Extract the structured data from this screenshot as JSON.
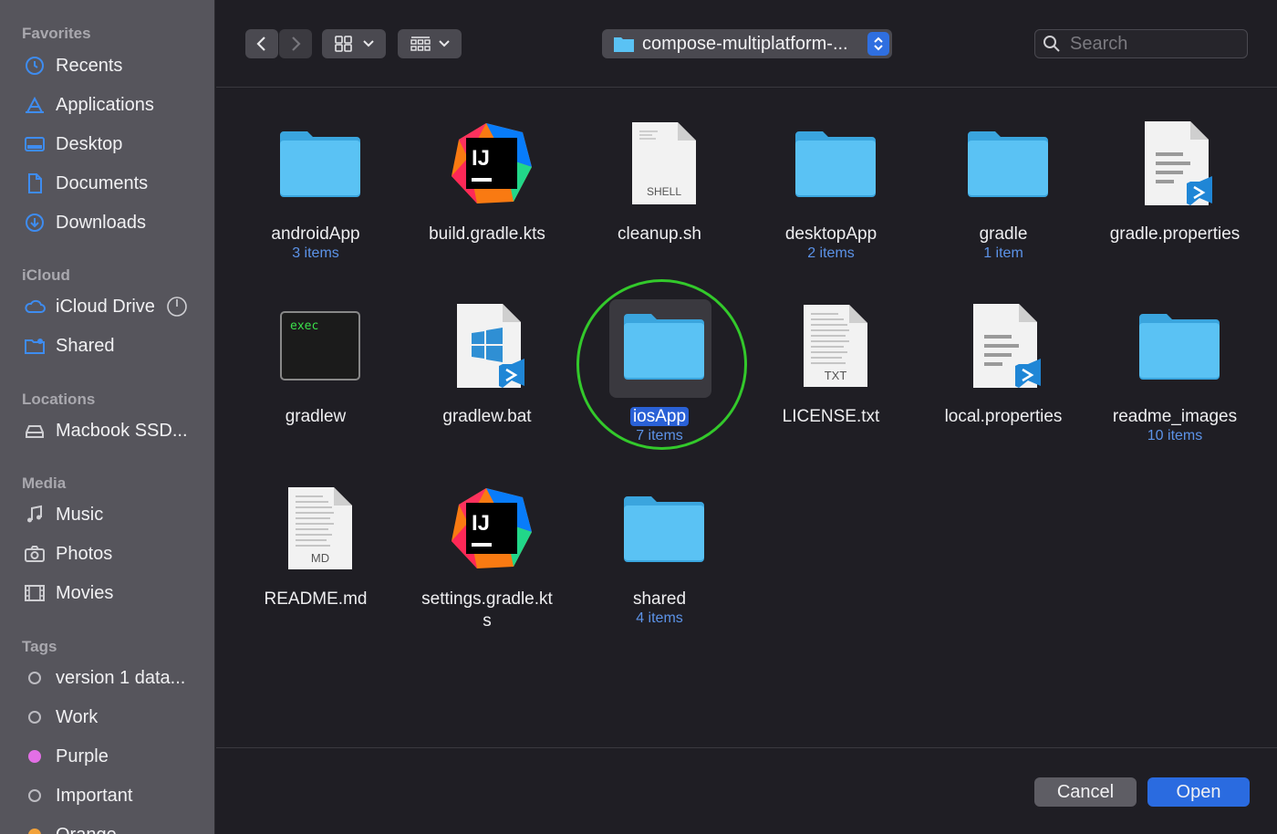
{
  "sidebar": {
    "sections": [
      {
        "title": "Favorites"
      },
      {
        "title": "iCloud"
      },
      {
        "title": "Locations"
      },
      {
        "title": "Media"
      },
      {
        "title": "Tags"
      }
    ],
    "favorites": [
      {
        "label": "Recents",
        "icon": "clock-icon"
      },
      {
        "label": "Applications",
        "icon": "applications-icon"
      },
      {
        "label": "Desktop",
        "icon": "desktop-icon"
      },
      {
        "label": "Documents",
        "icon": "document-icon"
      },
      {
        "label": "Downloads",
        "icon": "download-icon"
      }
    ],
    "icloud": [
      {
        "label": "iCloud Drive",
        "icon": "cloud-icon"
      },
      {
        "label": "Shared",
        "icon": "shared-folder-icon"
      }
    ],
    "locations": [
      {
        "label": "Macbook SSD...",
        "icon": "disk-icon"
      }
    ],
    "media": [
      {
        "label": "Music",
        "icon": "music-icon"
      },
      {
        "label": "Photos",
        "icon": "camera-icon"
      },
      {
        "label": "Movies",
        "icon": "film-icon"
      }
    ],
    "tags": [
      {
        "label": "version 1 data...",
        "color": ""
      },
      {
        "label": "Work",
        "color": ""
      },
      {
        "label": "Purple",
        "color": "#e36fe6"
      },
      {
        "label": "Important",
        "color": ""
      },
      {
        "label": "Orange",
        "color": "#f2a23a"
      }
    ]
  },
  "toolbar": {
    "path_label": "compose-multiplatform-...",
    "search_placeholder": "Search"
  },
  "files": [
    {
      "name": "androidApp",
      "sub": "3 items",
      "kind": "folder"
    },
    {
      "name": "build.gradle.kts",
      "sub": "",
      "kind": "intellij"
    },
    {
      "name": "cleanup.sh",
      "sub": "",
      "kind": "shell",
      "badge": "SHELL"
    },
    {
      "name": "desktopApp",
      "sub": "2 items",
      "kind": "folder"
    },
    {
      "name": "gradle",
      "sub": "1 item",
      "kind": "folder"
    },
    {
      "name": "gradle.properties",
      "sub": "",
      "kind": "vscode-doc"
    },
    {
      "name": "gradlew",
      "sub": "",
      "kind": "exec",
      "badge": "exec"
    },
    {
      "name": "gradlew.bat",
      "sub": "",
      "kind": "windows-vscode"
    },
    {
      "name": "iosApp",
      "sub": "7 items",
      "kind": "folder",
      "selected": true
    },
    {
      "name": "LICENSE.txt",
      "sub": "",
      "kind": "text-doc",
      "badge": "TXT"
    },
    {
      "name": "local.properties",
      "sub": "",
      "kind": "vscode-doc"
    },
    {
      "name": "readme_images",
      "sub": "10 items",
      "kind": "folder"
    },
    {
      "name": "README.md",
      "sub": "",
      "kind": "text-doc",
      "badge": "MD"
    },
    {
      "name": "settings.gradle.kts",
      "name_line1": "settings.gradle.kt",
      "name_line2": "s",
      "sub": "",
      "kind": "intellij"
    },
    {
      "name": "shared",
      "sub": "4 items",
      "kind": "folder"
    }
  ],
  "footer": {
    "cancel_label": "Cancel",
    "open_label": "Open"
  },
  "colors": {
    "accent": "#2a6be0",
    "folder": "#5ac2f4",
    "highlight_ring": "#33c92b"
  }
}
